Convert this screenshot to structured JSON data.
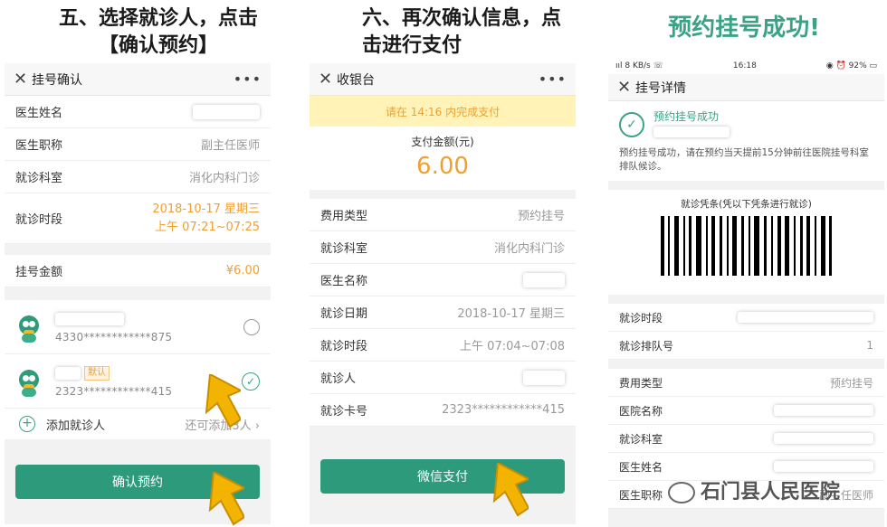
{
  "headings": {
    "step5": "五、选择就诊人，点击【确认预约】",
    "step6": "六、再次确认信息，点击进行支付",
    "success": "预约挂号成功!"
  },
  "confirm": {
    "title": "挂号确认",
    "doctor_name_label": "医生姓名",
    "doctor_title_label": "医生职称",
    "doctor_title_value": "副主任医师",
    "dept_label": "就诊科室",
    "dept_value": "消化内科门诊",
    "time_label": "就诊时段",
    "time_date": "2018-10-17 星期三",
    "time_slot": "上午 07:21~07:25",
    "fee_label": "挂号金额",
    "fee_value": "¥6.00",
    "patients": [
      {
        "card": "4330************875",
        "tag": ""
      },
      {
        "card": "2323************415",
        "tag": "默认"
      }
    ],
    "add_label": "添加就诊人",
    "add_hint": "还可添加3人 ›",
    "confirm_button": "确认预约"
  },
  "cashier": {
    "title": "收银台",
    "banner": "请在 14:16 内完成支付",
    "amount_label": "支付金额(元)",
    "amount": "6.00",
    "rows": {
      "fee_type_label": "费用类型",
      "fee_type_value": "预约挂号",
      "dept_label": "就诊科室",
      "dept_value": "消化内科门诊",
      "doctor_label": "医生名称",
      "date_label": "就诊日期",
      "date_value": "2018-10-17 星期三",
      "slot_label": "就诊时段",
      "slot_value": "上午 07:04~07:08",
      "patient_label": "就诊人",
      "card_label": "就诊卡号",
      "card_value": "2323************415"
    },
    "pay_button": "微信支付"
  },
  "detail": {
    "status_left": "ııl 8 KB/s ☏",
    "status_time": "16:18",
    "status_right": "◉ ⏰ 92% ▭",
    "title": "挂号详情",
    "success_title": "预约挂号成功",
    "success_desc": "预约挂号成功，请在预约当天提前15分钟前往医院挂号科室排队候诊。",
    "voucher_label": "就诊凭条(凭以下凭条进行就诊)",
    "time_label": "就诊时段",
    "queue_label": "就诊排队号",
    "queue_value": "1",
    "fee_type_label": "费用类型",
    "fee_type_value": "预约挂号",
    "hospital_label": "医院名称",
    "dept_label": "就诊科室",
    "doctor_label": "医生姓名",
    "doctor_title_label": "医生职称",
    "doctor_title_value": "副主任医师"
  },
  "watermark": "石门县人民医院",
  "icons": {
    "close": "close-icon",
    "more": "more-icon",
    "check": "check-icon",
    "plus": "plus-icon",
    "arrow": "arrow-icon"
  },
  "colors": {
    "accent": "#2e9a7c",
    "orange": "#f0a030",
    "banner": "#fff3b8"
  }
}
